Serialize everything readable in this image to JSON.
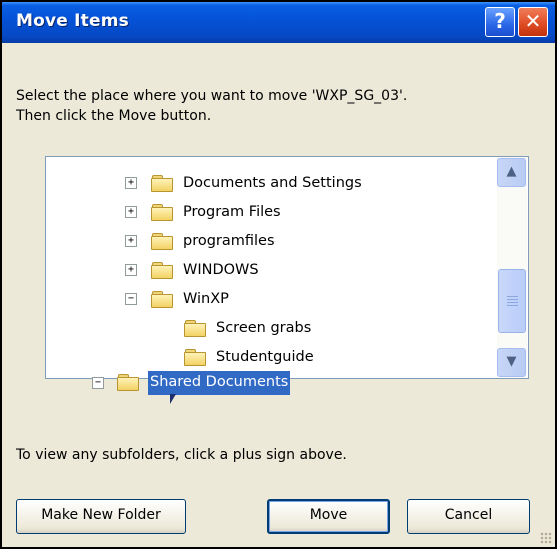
{
  "window": {
    "title": "Move Items",
    "help_glyph": "?",
    "close_glyph": "✕"
  },
  "instructions": {
    "line1": "Select the place where you want to move 'WXP_SG_03'.",
    "line2": "Then click the Move button."
  },
  "tree": {
    "items": [
      {
        "label": "Documents and Settings",
        "expander": "+",
        "selected": false
      },
      {
        "label": "Program Files",
        "expander": "+",
        "selected": false
      },
      {
        "label": "programfiles",
        "expander": "+",
        "selected": false
      },
      {
        "label": "WINDOWS",
        "expander": "+",
        "selected": false
      },
      {
        "label": "WinXP",
        "expander": "−",
        "selected": false
      },
      {
        "label": "Screen grabs",
        "expander": "",
        "selected": false
      },
      {
        "label": "Studentguide",
        "expander": "",
        "selected": false
      },
      {
        "label": "Shared Documents",
        "expander": "−",
        "selected": true
      }
    ],
    "scroll_up_glyph": "▲",
    "scroll_down_glyph": "▼"
  },
  "hint": "To view any subfolders, click a plus sign above.",
  "buttons": {
    "make_new_folder": "Make New Folder",
    "move": "Move",
    "cancel": "Cancel"
  },
  "colors": {
    "titlebar": "#0553d8",
    "selection": "#316ac5",
    "dialog_bg": "#ece9d8"
  }
}
